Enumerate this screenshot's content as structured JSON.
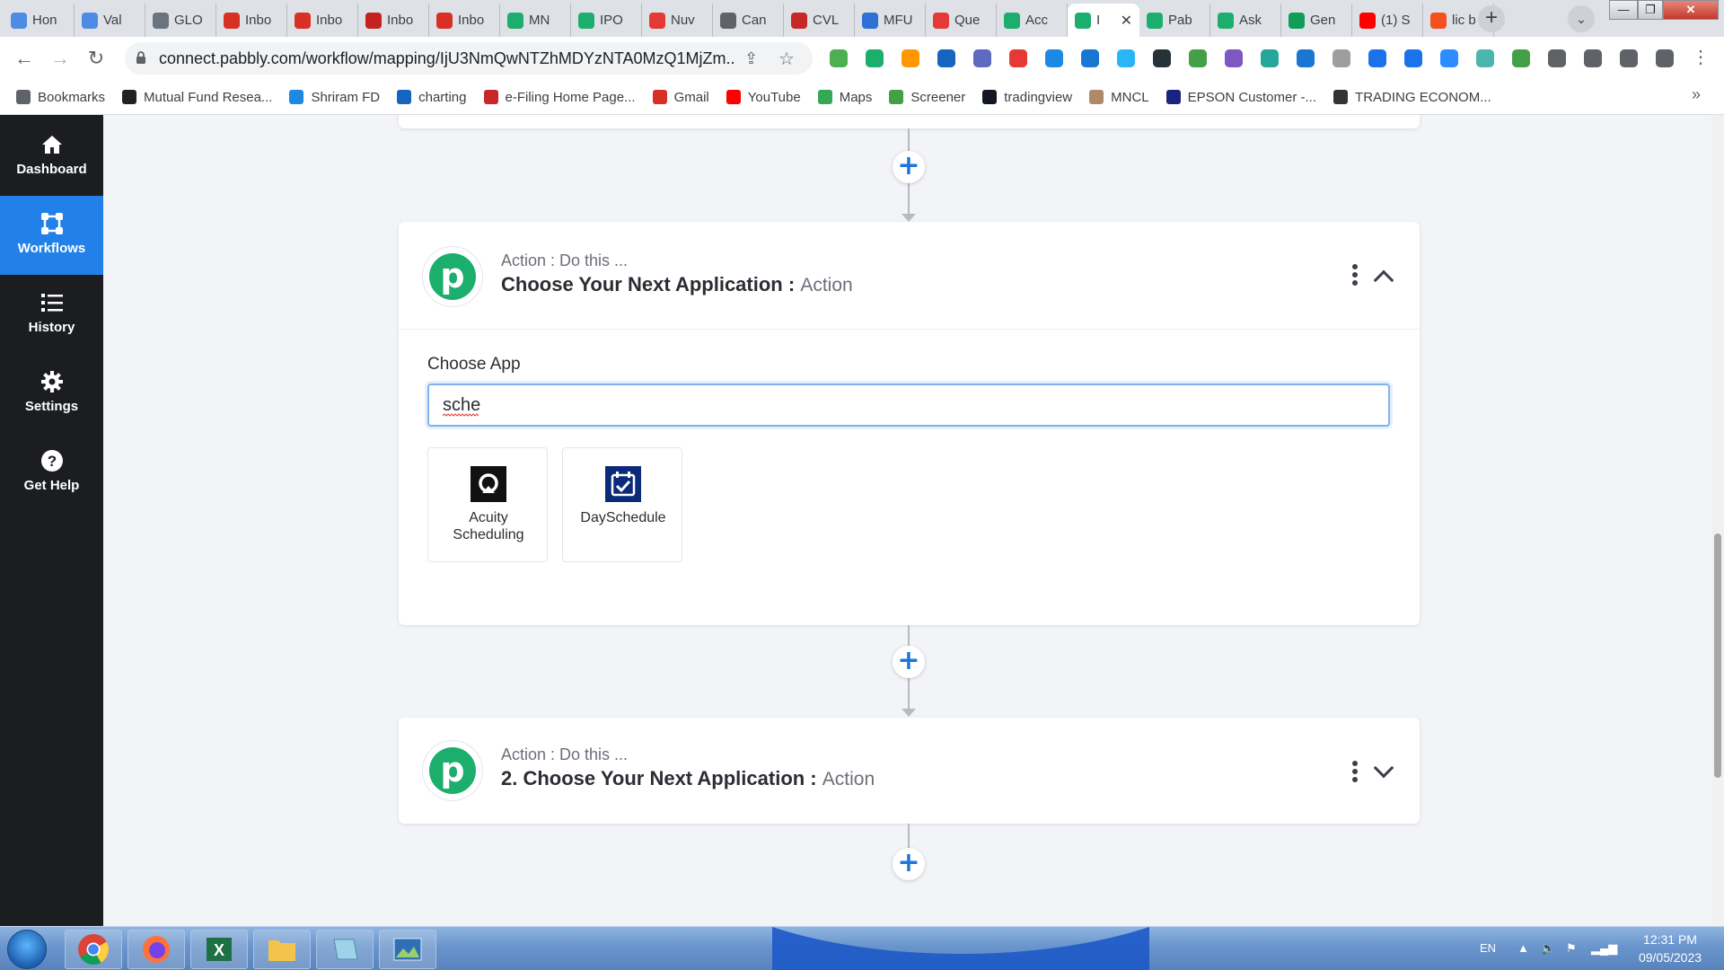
{
  "browser": {
    "tabs": [
      {
        "title": "Hon",
        "favicon": "#4d8be6"
      },
      {
        "title": "Val",
        "favicon": "#4d8be6"
      },
      {
        "title": "GLO",
        "favicon": "#6b7280"
      },
      {
        "title": "Inbo",
        "favicon": "#d93025"
      },
      {
        "title": "Inbo",
        "favicon": "#d93025"
      },
      {
        "title": "Inbo",
        "favicon": "#c5221f"
      },
      {
        "title": "Inbo",
        "favicon": "#d93025"
      },
      {
        "title": "MN",
        "favicon": "#1cae6c"
      },
      {
        "title": "IPO",
        "favicon": "#1cae6c"
      },
      {
        "title": "Nuv",
        "favicon": "#e53935"
      },
      {
        "title": "Can",
        "favicon": "#5f6368"
      },
      {
        "title": "CVL",
        "favicon": "#c62828"
      },
      {
        "title": "MFU",
        "favicon": "#2f6fd6"
      },
      {
        "title": "Que",
        "favicon": "#e53935"
      },
      {
        "title": "Acc",
        "favicon": "#1cae6c"
      },
      {
        "title": "I",
        "favicon": "#1cae6c",
        "active": true
      },
      {
        "title": "Pab",
        "favicon": "#1cae6c"
      },
      {
        "title": "Ask",
        "favicon": "#1cae6c"
      },
      {
        "title": "Gen",
        "favicon": "#0f9d58"
      },
      {
        "title": "(1) S",
        "favicon": "#ff0000"
      },
      {
        "title": "lic b",
        "favicon": "#f4511e"
      }
    ],
    "new_tab_symbol": "+",
    "window_buttons": {
      "minimize": "—",
      "maximize": "❐",
      "close": "✕"
    },
    "url": "connect.pabbly.com/workflow/mapping/IjU3NmQwNTZhMDYzNTA0MzQ1MjZm...",
    "bookmarks": [
      {
        "label": "Bookmarks",
        "color": "#5f6368"
      },
      {
        "label": "Mutual Fund Resea...",
        "color": "#222222"
      },
      {
        "label": "Shriram FD",
        "color": "#1e88e5"
      },
      {
        "label": "charting",
        "color": "#1565c0"
      },
      {
        "label": "e-Filing Home Page...",
        "color": "#c62828"
      },
      {
        "label": "Gmail",
        "color": "#d93025"
      },
      {
        "label": "YouTube",
        "color": "#ff0000"
      },
      {
        "label": "Maps",
        "color": "#34a853"
      },
      {
        "label": "Screener",
        "color": "#43a047"
      },
      {
        "label": "tradingview",
        "color": "#131722"
      },
      {
        "label": "MNCL",
        "color": "#b08968"
      },
      {
        "label": "EPSON Customer -...",
        "color": "#1a237e"
      },
      {
        "label": "TRADING ECONOM...",
        "color": "#333333"
      }
    ],
    "extension_colors": [
      "#4caf50",
      "#1cae6c",
      "#ff9800",
      "#1565c0",
      "#5c6bc0",
      "#e53935",
      "#1e88e5",
      "#1976d2",
      "#29b6f6",
      "#263238",
      "#43a047",
      "#7e57c2",
      "#26a69a",
      "#1976d2",
      "#9e9e9e",
      "#1a73e8",
      "#1a73e8",
      "#2d8cff",
      "#4db6ac",
      "#43a047",
      "#5f6368",
      "#5f6368",
      "#5f6368",
      "#5f6368"
    ]
  },
  "sidebar": {
    "items": [
      {
        "label": "Dashboard",
        "icon": "home-icon"
      },
      {
        "label": "Workflows",
        "icon": "workflow-icon",
        "active": true
      },
      {
        "label": "History",
        "icon": "history-list-icon"
      },
      {
        "label": "Settings",
        "icon": "gear-icon"
      },
      {
        "label": "Get Help",
        "icon": "help-icon"
      }
    ]
  },
  "workflow": {
    "active_step": {
      "subtitle": "Action : Do this ...",
      "title": "Choose Your Next Application :",
      "tag": "Action",
      "choose_app_label": "Choose App",
      "search_value": "sche",
      "results": [
        {
          "name_line1": "Acuity",
          "name_line2": "Scheduling",
          "icon": "acuity-scheduling-logo"
        },
        {
          "name_line1": "DaySchedule",
          "name_line2": "",
          "icon": "dayschedule-logo"
        }
      ]
    },
    "next_step": {
      "subtitle": "Action : Do this ...",
      "title": "2. Choose Your Next Application :",
      "tag": "Action"
    },
    "add_step_symbol": "+",
    "logo_letter": "p"
  },
  "taskbar": {
    "language": "EN",
    "time": "12:31 PM",
    "date": "09/05/2023"
  }
}
